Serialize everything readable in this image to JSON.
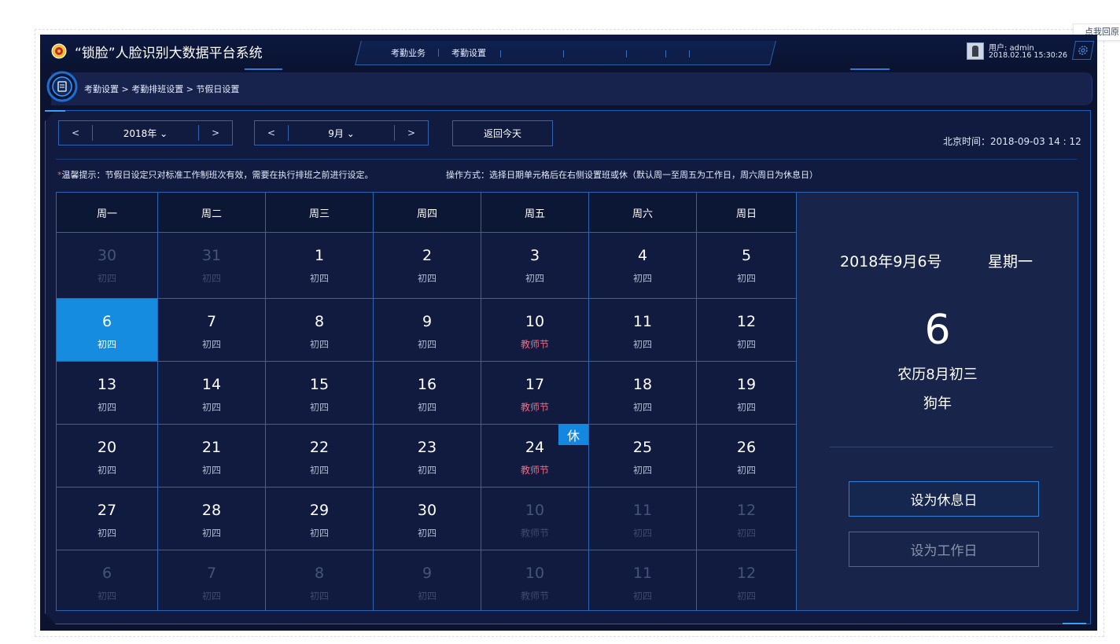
{
  "back_link": "点我回原",
  "header": {
    "title": "“锁脸”人脸识别大数据平台系统",
    "nav": [
      "考勤业务",
      "考勤设置"
    ],
    "user": "用户: admin",
    "datetime": "2018.02.16  15:30:26"
  },
  "breadcrumb": "考勤设置 > 考勤排班设置 > 节假日设置",
  "controls": {
    "year": "2018年",
    "month": "9月",
    "prev": "<",
    "next": ">",
    "today": "返回今天",
    "beijing_time": "北京时间：2018-09-03 14 : 12"
  },
  "tips": {
    "warm_star": "*",
    "warm": "温馨提示：节假日设定只对标准工作制班次有效，需要在执行排班之前进行设定。",
    "operation": "操作方式：选择日期单元格后在右侧设置班或休（默认周一至周五为工作日，周六周日为休息日）"
  },
  "calendar": {
    "weekdays": [
      "周一",
      "周二",
      "周三",
      "周四",
      "周五",
      "周六",
      "周日"
    ],
    "rows": [
      [
        {
          "d": "30",
          "l": "初四",
          "m": true
        },
        {
          "d": "31",
          "l": "初四",
          "m": true
        },
        {
          "d": "1",
          "l": "初四"
        },
        {
          "d": "2",
          "l": "初四"
        },
        {
          "d": "3",
          "l": "初四"
        },
        {
          "d": "4",
          "l": "初四"
        },
        {
          "d": "5",
          "l": "初四"
        }
      ],
      [
        {
          "d": "6",
          "l": "初四",
          "s": true
        },
        {
          "d": "7",
          "l": "初四"
        },
        {
          "d": "8",
          "l": "初四"
        },
        {
          "d": "9",
          "l": "初四"
        },
        {
          "d": "10",
          "l": "教师节",
          "h": true
        },
        {
          "d": "11",
          "l": "初四"
        },
        {
          "d": "12",
          "l": "初四"
        }
      ],
      [
        {
          "d": "13",
          "l": "初四"
        },
        {
          "d": "14",
          "l": "初四"
        },
        {
          "d": "15",
          "l": "初四"
        },
        {
          "d": "16",
          "l": "初四"
        },
        {
          "d": "17",
          "l": "教师节",
          "h": true
        },
        {
          "d": "18",
          "l": "初四"
        },
        {
          "d": "19",
          "l": "初四"
        }
      ],
      [
        {
          "d": "20",
          "l": "初四"
        },
        {
          "d": "21",
          "l": "初四"
        },
        {
          "d": "22",
          "l": "初四"
        },
        {
          "d": "23",
          "l": "初四"
        },
        {
          "d": "24",
          "l": "教师节",
          "h": true
        },
        {
          "d": "25",
          "l": "初四"
        },
        {
          "d": "26",
          "l": "初四"
        }
      ],
      [
        {
          "d": "27",
          "l": "初四"
        },
        {
          "d": "28",
          "l": "初四"
        },
        {
          "d": "29",
          "l": "初四"
        },
        {
          "d": "30",
          "l": "初四"
        },
        {
          "d": "10",
          "l": "教师节",
          "m": true,
          "h": true
        },
        {
          "d": "11",
          "l": "初四",
          "m": true
        },
        {
          "d": "12",
          "l": "初四",
          "m": true
        }
      ],
      [
        {
          "d": "6",
          "l": "初四",
          "m": true
        },
        {
          "d": "7",
          "l": "初四",
          "m": true
        },
        {
          "d": "8",
          "l": "初四",
          "m": true
        },
        {
          "d": "9",
          "l": "初四",
          "m": true
        },
        {
          "d": "10",
          "l": "教师节",
          "m": true,
          "h": true
        },
        {
          "d": "11",
          "l": "初四",
          "m": true
        },
        {
          "d": "12",
          "l": "初四",
          "m": true
        }
      ]
    ],
    "rest_badge": "休"
  },
  "side": {
    "date": "2018年9月6号",
    "weekday": "星期一",
    "day": "6",
    "lunar": "农历8月初三",
    "zodiac": "狗年",
    "set_rest": "设为休息日",
    "set_work": "设为工作日"
  },
  "colors": {
    "background": "#0b1331",
    "accent": "#168ce0",
    "holiday": "#f56a7a",
    "border": "#2d65b5"
  },
  "icons": [
    "police-badge-icon",
    "avatar-icon",
    "gear-icon",
    "document-icon"
  ]
}
